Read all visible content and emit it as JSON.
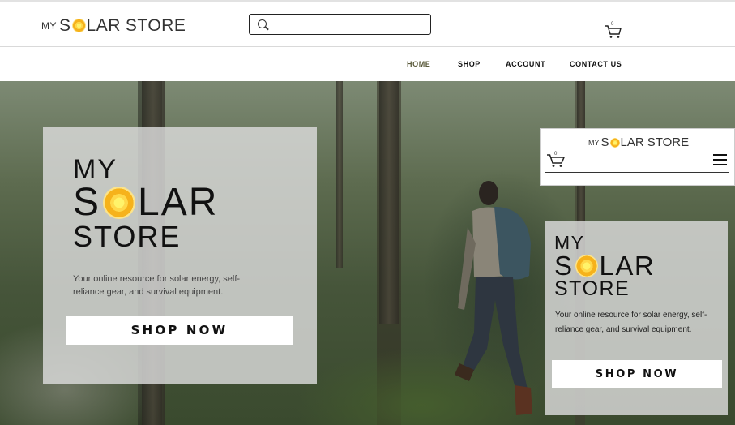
{
  "header": {
    "logo": {
      "my": "MY",
      "word_before": "S",
      "word_after": "LAR",
      "store": "STORE"
    },
    "search": {
      "placeholder": ""
    },
    "cart": {
      "count": "0"
    }
  },
  "nav": {
    "items": [
      {
        "label": "HOME",
        "active": true
      },
      {
        "label": "SHOP"
      },
      {
        "label": "ACCOUNT"
      },
      {
        "label": "CONTACT US"
      }
    ]
  },
  "hero": {
    "logo": {
      "my": "MY",
      "word_before": "S",
      "word_after": "LAR",
      "store": "STORE"
    },
    "tagline": "Your online resource for solar energy, self-reliance gear, and survival equipment.",
    "cta": "SHOP NOW"
  },
  "mobile": {
    "logo": {
      "my": "MY",
      "word_before": "S",
      "word_after": "LAR",
      "store": "STORE"
    },
    "cart": {
      "count": "0"
    },
    "hero": {
      "logo": {
        "my": "MY",
        "word_before": "S",
        "word_after": "LAR",
        "store": "STORE"
      },
      "tagline": "Your online resource for solar energy, self-reliance gear, and survival equipment.",
      "cta": "SHOP NOW"
    }
  },
  "colors": {
    "sun_core": "#fff36a",
    "sun_ring": "#f6b21b",
    "panel_bg": "#dcdcdc",
    "nav_active": "#5a5a3a"
  }
}
